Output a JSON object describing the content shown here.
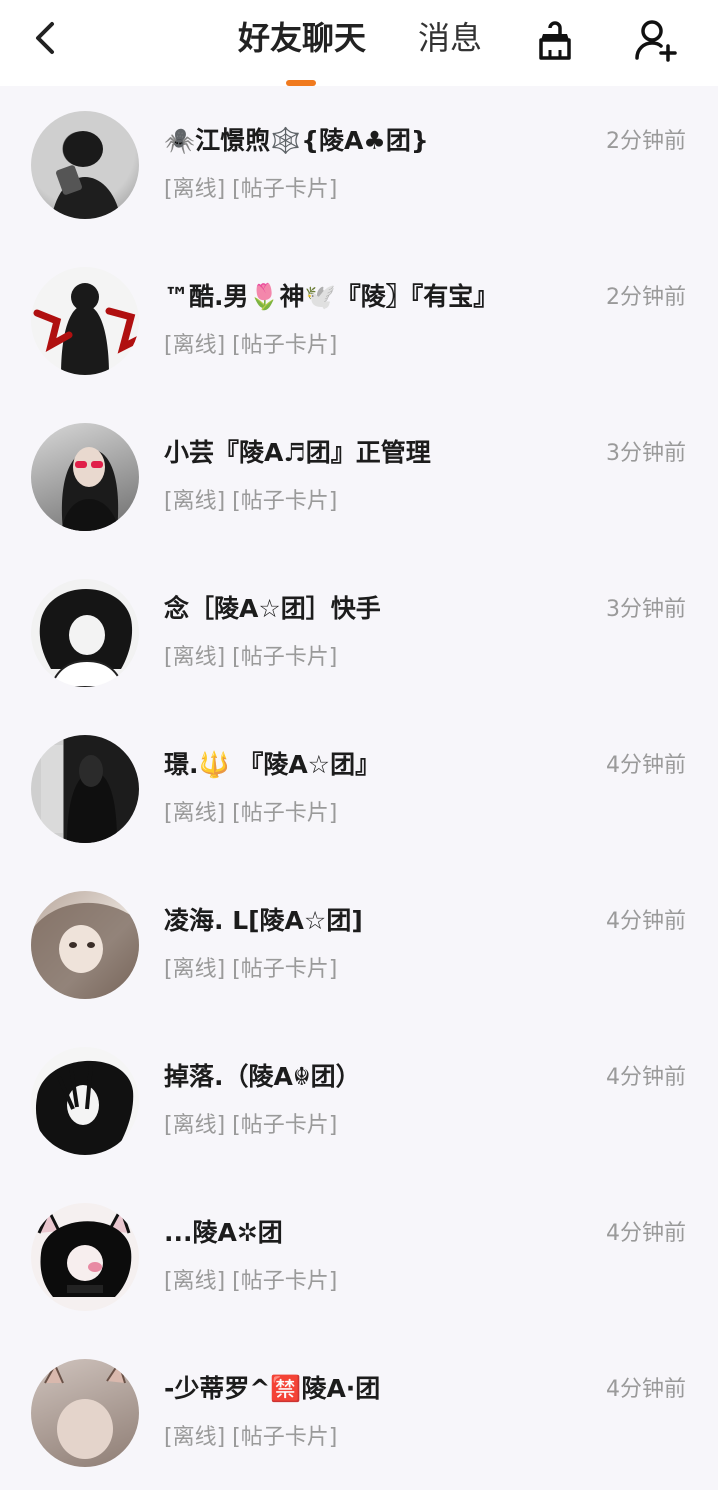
{
  "header": {
    "tabs": [
      {
        "label": "好友聊天",
        "active": true
      },
      {
        "label": "消息",
        "active": false
      }
    ],
    "accent_color": "#f07a1e",
    "icons": [
      "back-arrow-icon",
      "broom-icon",
      "add-friend-icon"
    ]
  },
  "chats": [
    {
      "name": "🕷️江憬煦🕸️{陵A♣团}",
      "status": "[离线] [帖子卡片]",
      "time": "2分钟前"
    },
    {
      "name": "™酷.男🌷神🕊️『陵〗『有宝』",
      "status": "[离线] [帖子卡片]",
      "time": "2分钟前"
    },
    {
      "name": "小芸『陵A♬团』正管理",
      "status": "[离线] [帖子卡片]",
      "time": "3分钟前"
    },
    {
      "name": "念［陵A☆团］快手",
      "status": "[离线] [帖子卡片]",
      "time": "3分钟前"
    },
    {
      "name": "璟.🔱 『陵A☆团』",
      "status": "[离线] [帖子卡片]",
      "time": "4分钟前"
    },
    {
      "name": "凌海. L[陵A☆团]",
      "status": "[离线] [帖子卡片]",
      "time": "4分钟前"
    },
    {
      "name": "掉落.（陵A☬团）",
      "status": "[离线] [帖子卡片]",
      "time": "4分钟前"
    },
    {
      "name": "...陵A✲团",
      "status": "[离线] [帖子卡片]",
      "time": "4分钟前"
    },
    {
      "name": "-少蒂罗^🈲陵A·团",
      "status": "[离线] [帖子卡片]",
      "time": "4分钟前"
    }
  ]
}
